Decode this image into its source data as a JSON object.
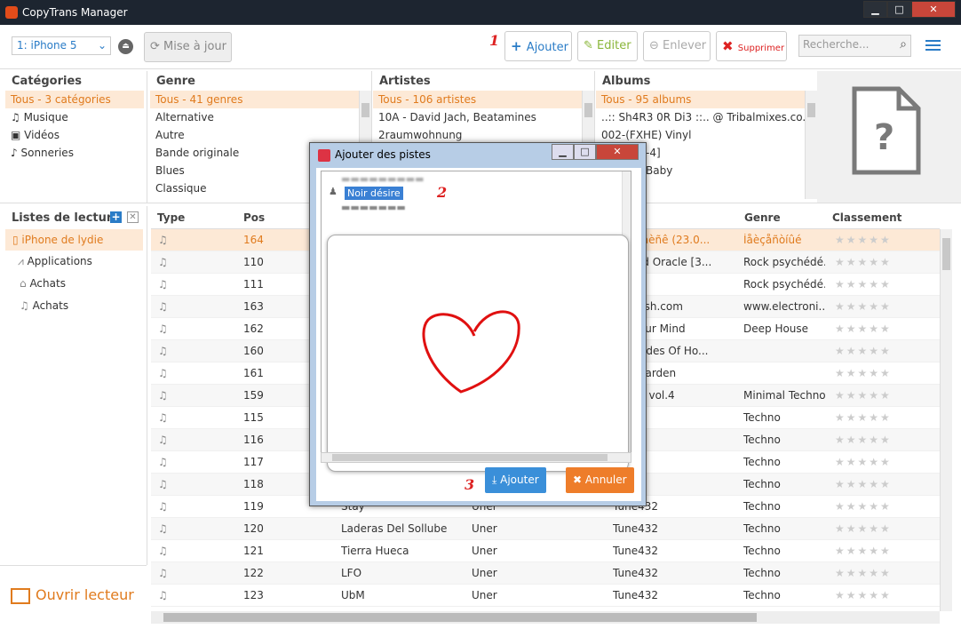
{
  "window": {
    "title": "CopyTrans Manager",
    "minimize": "▁",
    "maximize": "□",
    "close": "✕"
  },
  "toolbar": {
    "device": "1: iPhone 5",
    "update_label": "Mise à jour",
    "add_label": "Ajouter",
    "edit_label": "Editer",
    "remove_label": "Enlever",
    "delete_label": "Supprimer",
    "search_placeholder": "Recherche...",
    "marker": "1"
  },
  "categories": {
    "header": "Catégories",
    "items": [
      {
        "label": "Tous - 3 catégories",
        "icon": "all"
      },
      {
        "label": "Musique",
        "icon": "music-note-icon"
      },
      {
        "label": "Vidéos",
        "icon": "video-icon"
      },
      {
        "label": "Sonneries",
        "icon": "bell-icon"
      }
    ]
  },
  "genre": {
    "header": "Genre",
    "items": [
      "Tous - 41 genres",
      "Alternative",
      "Autre",
      "Bande originale",
      "Blues",
      "Classique"
    ]
  },
  "artists": {
    "header": "Artistes",
    "items": [
      "Tous - 106 artistes",
      "10A - David Jach, Beatamines",
      "2raumwohnung"
    ]
  },
  "albums": {
    "header": "Albums",
    "items": [
      "Tous - 95 albums",
      "..:: Sh4R3 0R Di3 ::.. @ Tribalmixes.co...",
      "002-(FXHE) Vinyl",
      "-4]",
      "Baby"
    ]
  },
  "playlists": {
    "header": "Listes de lecture",
    "device_label": "iPhone de lydie",
    "items": [
      {
        "label": "Applications",
        "icon": "apps-icon"
      },
      {
        "label": "Achats",
        "icon": "basket-icon"
      },
      {
        "label": "Achats",
        "icon": "music-notes-icon"
      }
    ],
    "open_player": "Ouvrir lecteur"
  },
  "grid": {
    "columns": [
      "Type",
      "Pos",
      "Genre",
      "Classement"
    ],
    "rows": [
      {
        "pos": "164",
        "title": "",
        "artist": "",
        "album": "îôïûé äèñê (23.0...",
        "genre": "Íåèçåñòíûé",
        "selected": true
      },
      {
        "pos": "110",
        "title": "",
        "artist": "",
        "album": "ey and Oracle [3...",
        "genre": "Rock psychédé..."
      },
      {
        "pos": "111",
        "title": "",
        "artist": "",
        "album": "nom>",
        "genre": "Rock psychédé..."
      },
      {
        "pos": "163",
        "title": "",
        "artist": "",
        "album": "nicFresh.com",
        "genre": "www.electroni..."
      },
      {
        "pos": "162",
        "title": "",
        "artist": "",
        "album": "ver Your Mind",
        "genre": "Deep House"
      },
      {
        "pos": "160",
        "title": "",
        "artist": "",
        "album": "st Shades Of Ho...",
        "genre": ""
      },
      {
        "pos": "161",
        "title": "",
        "artist": "",
        "album": "cret Garden",
        "genre": ""
      },
      {
        "pos": "159",
        "title": "",
        "artist": "",
        "album": "inimal vol.4",
        "genre": "Minimal Techno"
      },
      {
        "pos": "115",
        "title": "",
        "artist": "",
        "album": "432",
        "genre": "Techno"
      },
      {
        "pos": "116",
        "title": "",
        "artist": "",
        "album": "432",
        "genre": "Techno"
      },
      {
        "pos": "117",
        "title": "",
        "artist": "",
        "album": "432",
        "genre": "Techno"
      },
      {
        "pos": "118",
        "title": "",
        "artist": "",
        "album": "432",
        "genre": "Techno"
      },
      {
        "pos": "119",
        "title": "Stay",
        "artist": "Uner",
        "album": "Tune432",
        "genre": "Techno"
      },
      {
        "pos": "120",
        "title": "Laderas Del Sollube",
        "artist": "Uner",
        "album": "Tune432",
        "genre": "Techno"
      },
      {
        "pos": "121",
        "title": "Tierra Hueca",
        "artist": "Uner",
        "album": "Tune432",
        "genre": "Techno"
      },
      {
        "pos": "122",
        "title": "LFO",
        "artist": "Uner",
        "album": "Tune432",
        "genre": "Techno"
      },
      {
        "pos": "123",
        "title": "UbM",
        "artist": "Uner",
        "album": "Tune432",
        "genre": "Techno"
      }
    ],
    "stars": "★★★★★"
  },
  "dialog": {
    "title": "Ajouter des pistes",
    "selected_node": "Noir désire",
    "marker2": "2",
    "marker3": "3",
    "add_label": "Ajouter",
    "cancel_label": "Annuler"
  },
  "colors": {
    "accent": "#e07b1e",
    "blue": "#2a7cc7",
    "heart": "#e01010"
  }
}
